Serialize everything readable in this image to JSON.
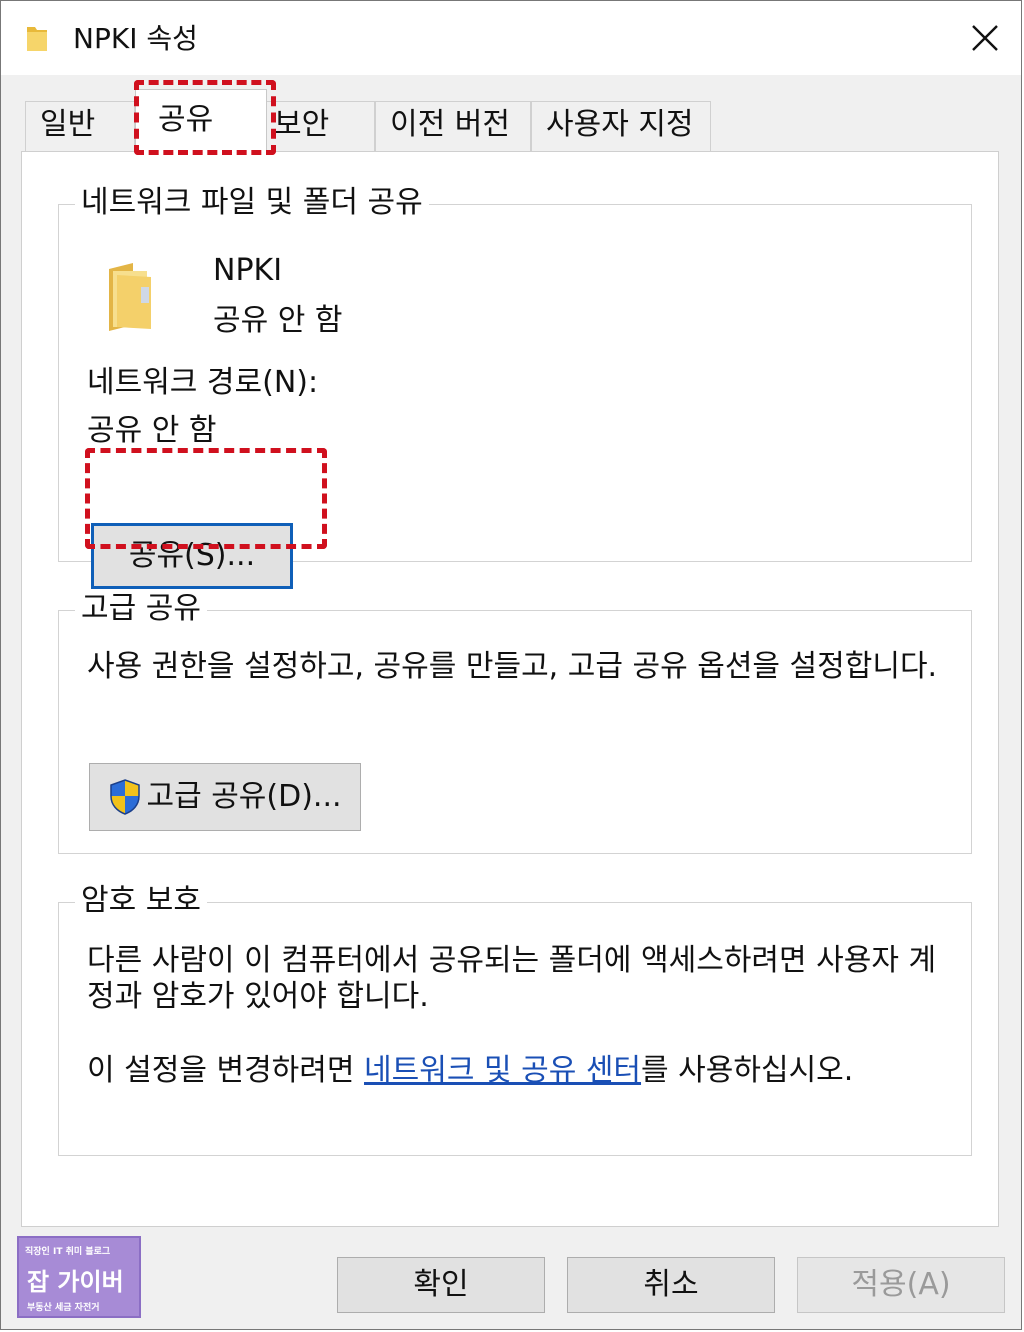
{
  "window": {
    "title": "NPKI 속성",
    "close_icon": "close-icon"
  },
  "tabs": [
    {
      "label": "일반",
      "active": false
    },
    {
      "label": "공유",
      "active": true
    },
    {
      "label": "보안",
      "active": false
    },
    {
      "label": "이전 버전",
      "active": false
    },
    {
      "label": "사용자 지정",
      "active": false
    }
  ],
  "network_share": {
    "group_title": "네트워크 파일 및 폴더 공유",
    "folder_name": "NPKI",
    "folder_status": "공유 안 함",
    "path_label": "네트워크 경로(N):",
    "path_value": "공유 안 함",
    "share_button": "공유(S)..."
  },
  "advanced_share": {
    "group_title": "고급 공유",
    "description": "사용 권한을 설정하고, 공유를 만들고, 고급 공유 옵션을 설정합니다.",
    "button": "고급 공유(D)...",
    "button_icon": "uac-shield-icon"
  },
  "password_protection": {
    "group_title": "암호 보호",
    "description": "다른 사람이 이 컴퓨터에서 공유되는 폴더에 액세스하려면 사용자 계정과 암호가 있어야 합니다.",
    "change_prefix": "이 설정을 변경하려면 ",
    "link_text": "네트워크 및 공유 센터",
    "change_suffix": "를 사용하십시오."
  },
  "footer": {
    "ok": "확인",
    "cancel": "취소",
    "apply": "적용(A)"
  },
  "watermark": {
    "top": "직장인 IT 취미 블로그",
    "main": "잡 가이버",
    "bottom": "부동산 세금 자전거"
  },
  "colors": {
    "highlight": "#d0101e",
    "focus_border": "#0f5fb8",
    "link": "#1a4fb5",
    "dialog_bg": "#f0f0f0"
  }
}
